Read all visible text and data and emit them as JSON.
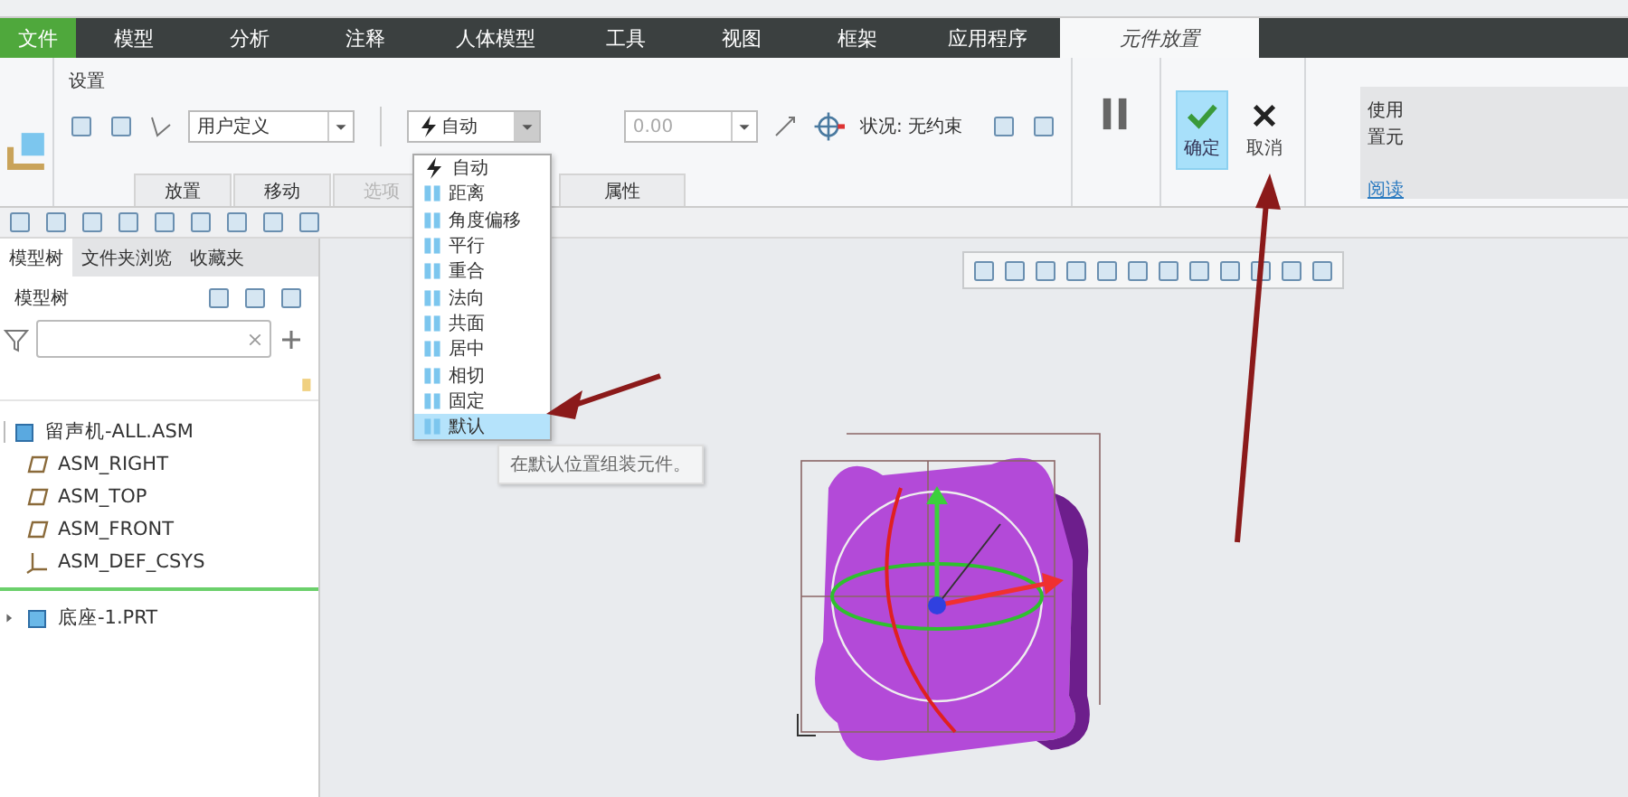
{
  "menu_tabs": [
    {
      "label": "文件",
      "kind": "file",
      "selected": false
    },
    {
      "label": "模型",
      "kind": "tab",
      "selected": false
    },
    {
      "label": "分析",
      "kind": "tab",
      "selected": false
    },
    {
      "label": "注释",
      "kind": "tab",
      "selected": false
    },
    {
      "label": "人体模型",
      "kind": "tab",
      "selected": false
    },
    {
      "label": "工具",
      "kind": "tab",
      "selected": false
    },
    {
      "label": "视图",
      "kind": "tab",
      "selected": false
    },
    {
      "label": "框架",
      "kind": "tab",
      "selected": false
    },
    {
      "label": "应用程序",
      "kind": "tab",
      "selected": false
    },
    {
      "label": "元件放置",
      "kind": "tab",
      "selected": true
    }
  ],
  "ribbon": {
    "group_label": "设置",
    "constraint_set": "用户定义",
    "constraint_type": "自动",
    "offset_value": "0.00",
    "status": "状况: 无约束",
    "ok": "确定",
    "cancel": "取消",
    "sub_tabs": [
      {
        "label": "放置",
        "disabled": false
      },
      {
        "label": "移动",
        "disabled": false
      },
      {
        "label": "选项",
        "disabled": true
      },
      {
        "label": "属性",
        "disabled": false
      }
    ]
  },
  "side_panel": {
    "lines": [
      "使用",
      "置元"
    ],
    "link": "阅读"
  },
  "dropdown": {
    "items": [
      {
        "label": "自动",
        "selected": false
      },
      {
        "label": "距离",
        "selected": false
      },
      {
        "label": "角度偏移",
        "selected": false
      },
      {
        "label": "平行",
        "selected": false
      },
      {
        "label": "重合",
        "selected": false
      },
      {
        "label": "法向",
        "selected": false
      },
      {
        "label": "共面",
        "selected": false
      },
      {
        "label": "居中",
        "selected": false
      },
      {
        "label": "相切",
        "selected": false
      },
      {
        "label": "固定",
        "selected": false
      },
      {
        "label": "默认",
        "selected": true
      }
    ],
    "tooltip": "在默认位置组装元件。"
  },
  "model_tree": {
    "tabs": [
      {
        "label": "模型树",
        "selected": true
      },
      {
        "label": "文件夹浏览",
        "selected": false
      },
      {
        "label": "收藏夹",
        "selected": false
      }
    ],
    "header": "模型树",
    "items": [
      {
        "label": "留声机-ALL.ASM",
        "kind": "assembly",
        "expanded": true,
        "children": [
          {
            "label": "ASM_RIGHT",
            "kind": "plane"
          },
          {
            "label": "ASM_TOP",
            "kind": "plane"
          },
          {
            "label": "ASM_FRONT",
            "kind": "plane"
          },
          {
            "label": "ASM_DEF_CSYS",
            "kind": "csys"
          }
        ]
      },
      {
        "label": "底座-1.PRT",
        "kind": "part",
        "expanded": false
      }
    ]
  }
}
